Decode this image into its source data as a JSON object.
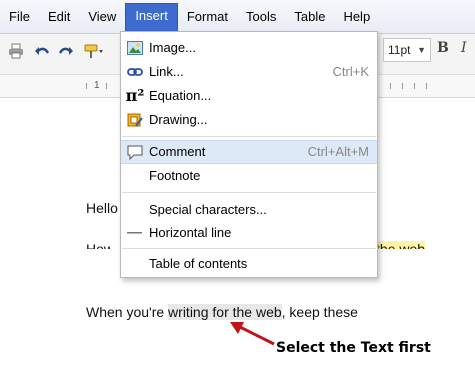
{
  "menubar": {
    "items": [
      "File",
      "Edit",
      "View",
      "Insert",
      "Format",
      "Tools",
      "Table",
      "Help"
    ]
  },
  "toolbar": {
    "font_size": "11pt",
    "bold_label": "B",
    "italic_label": "I"
  },
  "ruler": {
    "mark": "1"
  },
  "insert_menu": {
    "items": [
      {
        "label": "Image...",
        "shortcut": "",
        "icon": "image-icon"
      },
      {
        "label": "Link...",
        "shortcut": "Ctrl+K",
        "icon": "link-icon"
      },
      {
        "label": "Equation...",
        "shortcut": "",
        "icon": "equation-icon",
        "icon_text": "π²"
      },
      {
        "label": "Drawing...",
        "shortcut": "",
        "icon": "drawing-icon"
      },
      {
        "label": "Comment",
        "shortcut": "Ctrl+Alt+M",
        "icon": "comment-icon"
      },
      {
        "label": "Footnote",
        "shortcut": "",
        "icon": ""
      },
      {
        "label": "Special characters...",
        "shortcut": "",
        "icon": ""
      },
      {
        "label": "Horizontal line",
        "shortcut": "",
        "icon": "horizontal-line-icon"
      },
      {
        "label": "Table of contents",
        "shortcut": "",
        "icon": ""
      }
    ]
  },
  "document": {
    "line1": "Hello",
    "partial_left": "How",
    "partial_right": "the web",
    "line3_before": "When you're ",
    "line3_selected": "writing for the web",
    "line3_after": ", keep these"
  },
  "annotation": {
    "text": "Select the Text first",
    "color": "#c0141a"
  },
  "colors": {
    "menu_active": "#3e6bd0",
    "menu_hover": "#dde9f7"
  }
}
